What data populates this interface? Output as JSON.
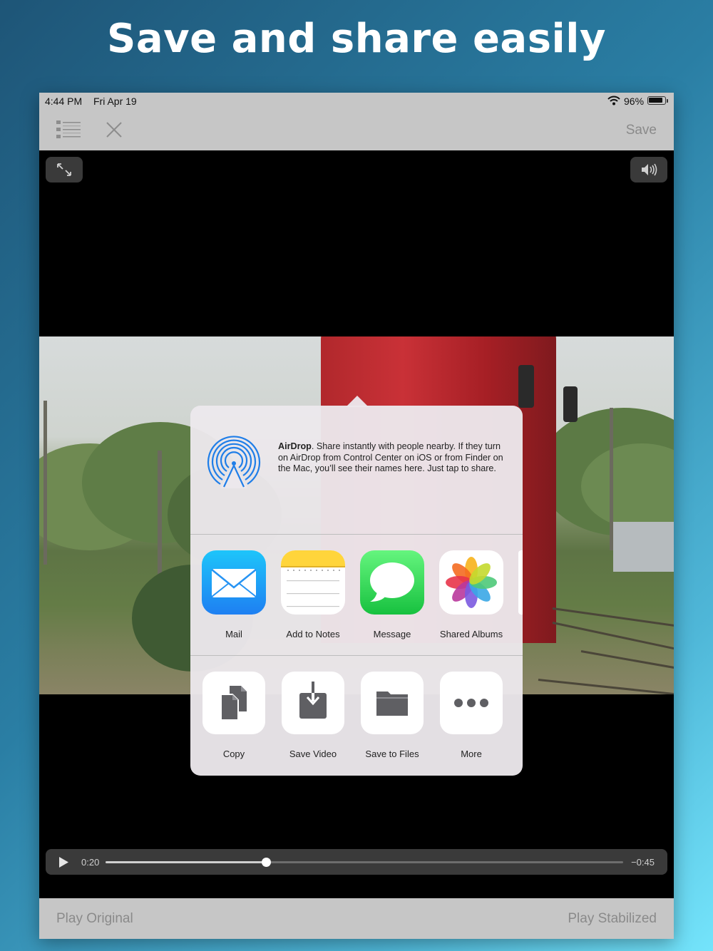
{
  "headline": "Save and share easily",
  "status_bar": {
    "time": "4:44 PM",
    "date": "Fri Apr 19",
    "battery": "96%",
    "battery_level": 0.96
  },
  "toolbar": {
    "save_label": "Save"
  },
  "share_sheet": {
    "airdrop": {
      "title": "AirDrop",
      "description": ". Share instantly with people nearby. If they turn on AirDrop from Control Center on iOS or from Finder on the Mac, you’ll see their names here. Just tap to share."
    },
    "apps": [
      {
        "label": "Mail",
        "icon": "mail-icon"
      },
      {
        "label": "Add to Notes",
        "icon": "notes-icon"
      },
      {
        "label": "Message",
        "icon": "message-icon"
      },
      {
        "label": "Shared Albums",
        "icon": "photos-icon"
      }
    ],
    "actions": [
      {
        "label": "Copy",
        "icon": "copy-icon"
      },
      {
        "label": "Save Video",
        "icon": "save-video-icon"
      },
      {
        "label": "Save to Files",
        "icon": "folder-icon"
      },
      {
        "label": "More",
        "icon": "more-icon"
      }
    ]
  },
  "player": {
    "current_time": "0:20",
    "remaining_time": "−0:45",
    "progress": 0.31
  },
  "bottom_bar": {
    "left_label": "Play Original",
    "right_label": "Play Stabilized"
  },
  "colors": {
    "mail_blue": "#1e8ef5",
    "notes_yellow": "#ffd53b",
    "message_green": "#2fd158",
    "airdrop_blue": "#1f7ee8",
    "bar_gray": "#c6c6c6"
  }
}
